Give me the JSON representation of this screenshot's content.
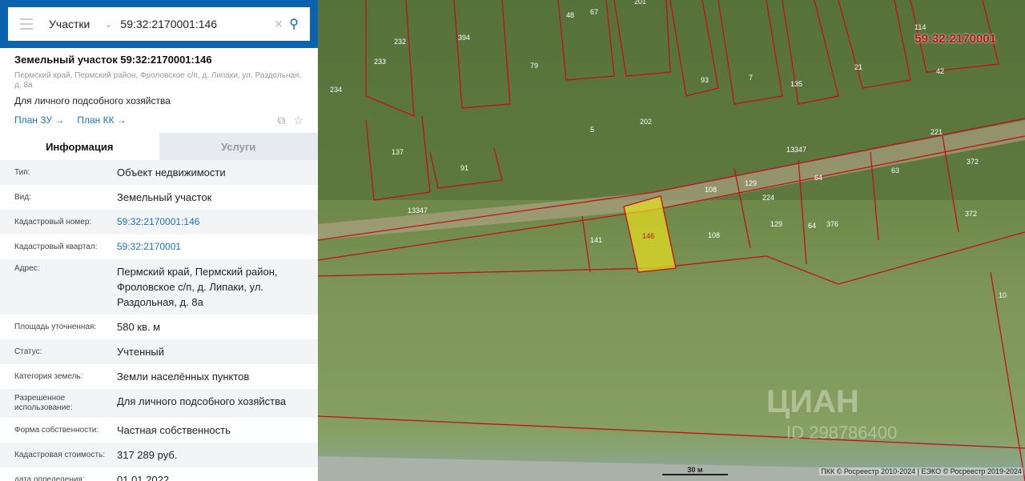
{
  "search": {
    "category": "Участки",
    "value": "59:32:2170001:146"
  },
  "card": {
    "title": "Земельный участок 59:32:2170001:146",
    "address": "Пермский край, Пермский район, Фроловское с/п, д. Липаки, ул. Раздольная, д. 8а",
    "purpose": "Для личного подсобного хозяйства",
    "link1": "План ЗУ →",
    "link2": "План КК →"
  },
  "tabs": {
    "info": "Информация",
    "services": "Услуги"
  },
  "rows": [
    {
      "k": "Тип:",
      "v": "Объект недвижимости"
    },
    {
      "k": "Вид:",
      "v": "Земельный участок"
    },
    {
      "k": "Кадастровый номер:",
      "v": "59:32:2170001:146"
    },
    {
      "k": "Кадастровый квартал:",
      "v": "59:32:2170001"
    },
    {
      "k": "Адрес:",
      "v": "Пермский край, Пермский район, Фроловское с/п, д. Липаки, ул. Раздольная, д. 8а"
    },
    {
      "k": "Площадь уточненная:",
      "v": "580 кв. м"
    },
    {
      "k": "Статус:",
      "v": "Учтенный"
    },
    {
      "k": "Категория земель:",
      "v": "Земли населённых пунктов"
    },
    {
      "k": "Разрешенное использование:",
      "v": "Для личного подсобного хозяйства"
    },
    {
      "k": "Форма собственности:",
      "v": "Частная собственность"
    },
    {
      "k": "Кадастровая стоимость:",
      "v": "317 289 руб."
    },
    {
      "k": "дата определения:",
      "v": "01.01.2022"
    }
  ],
  "map": {
    "quarter_label": "59:32:2170001",
    "selected_parcel": "146",
    "parcels": [
      "232",
      "394",
      "233",
      "234",
      "79",
      "48",
      "67",
      "201",
      "93",
      "7",
      "135",
      "21",
      "114",
      "42",
      "202",
      "5",
      "137",
      "91",
      "13347",
      "221",
      "372",
      "129",
      "108",
      "64",
      "63",
      "141",
      "13347",
      "224",
      "376",
      "108",
      "129",
      "64",
      "372",
      "10"
    ],
    "scale": "30 м",
    "copyright": "ПКК © Росреестр 2010-2024 | ЕЭКО © Росреестр 2019-2024",
    "watermark": "ЦИАН",
    "watermark_id": "ID 298786400",
    "selected_color": "#e8e020",
    "border_color": "#c0111a"
  }
}
